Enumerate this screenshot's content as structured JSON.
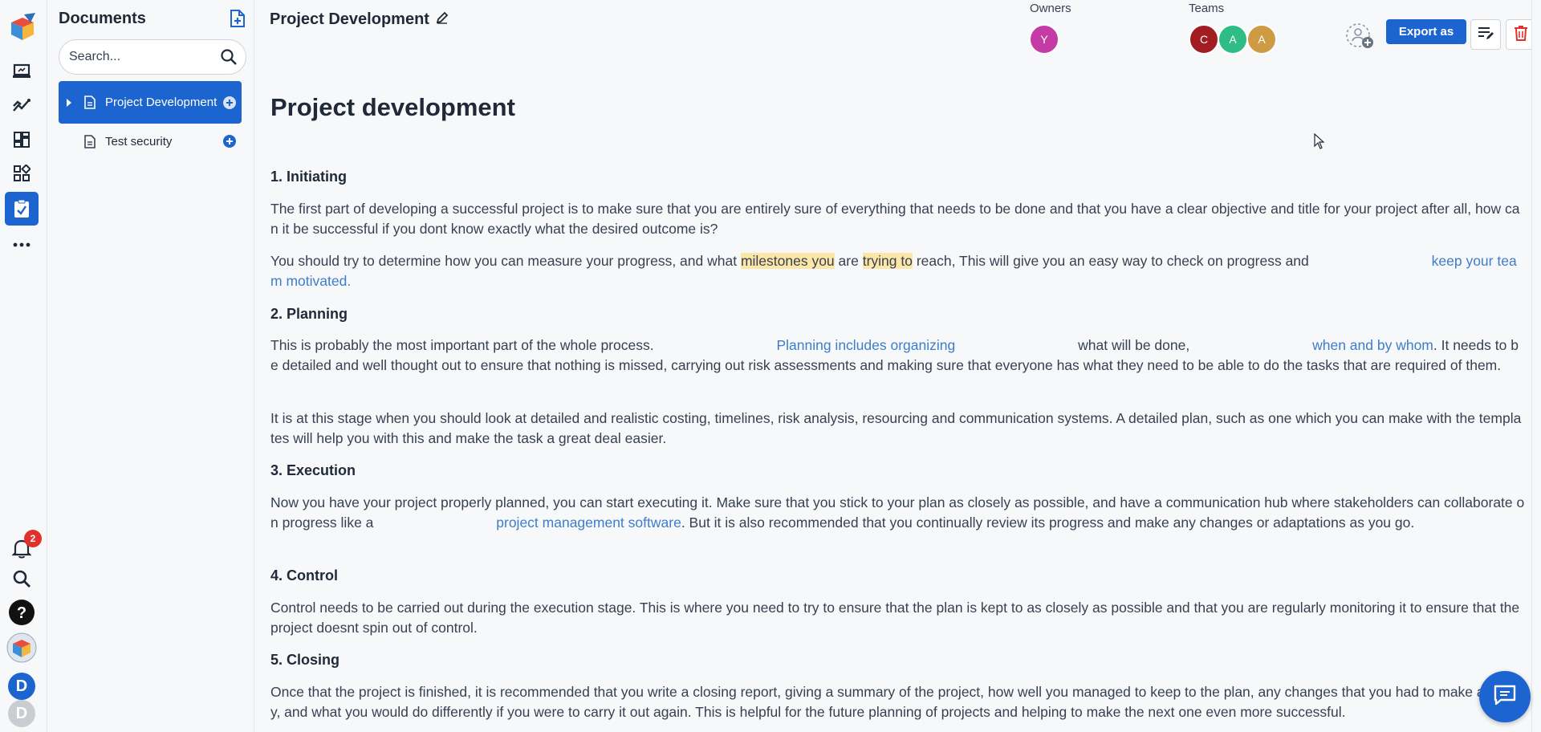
{
  "sidebar": {
    "title": "Documents",
    "search_placeholder": "Search...",
    "items": [
      {
        "label": "Project Development",
        "active": true
      },
      {
        "label": "Test security",
        "active": false
      }
    ]
  },
  "rail": {
    "notification_count": "2",
    "avatars": [
      "D",
      "D"
    ]
  },
  "header": {
    "title": "Project Development",
    "owners_label": "Owners",
    "teams_label": "Teams",
    "owners": [
      {
        "initial": "Y",
        "color": "#c53ba6"
      }
    ],
    "teams": [
      {
        "initial": "C",
        "color": "#a11d22"
      },
      {
        "initial": "A",
        "color": "#2ebd84"
      },
      {
        "initial": "A",
        "color": "#cf9a44"
      }
    ],
    "export_label": "Export as"
  },
  "document": {
    "heading": "Project development",
    "sections": [
      {
        "title": "1. Initiating",
        "p1": "The first part of developing a successful project is to make sure that you are entirely sure of everything that needs to be done and that you have a clear objective and title for your project after all, how can it be successful if you dont know exactly what the desired outcome is?",
        "p2a": "You should try to determine how you can measure your progress, and what ",
        "p2_hl1": "milestones you",
        "p2b": " are ",
        "p2_hl2": "trying to",
        "p2c": " reach, This will give you an easy way to check on progress and ",
        "p2_link": "keep your team motivated",
        "p2d": "."
      },
      {
        "title": "2. Planning",
        "p1a": "This is probably the most important part of the whole process. ",
        "p1_link1": "Planning includes organizing",
        "p1b": " what will be done, ",
        "p1_link2": "when and by whom",
        "p1c": ". It needs to be detailed and well thought out to ensure that nothing is missed, carrying out risk assessments and making sure that everyone has what they need to be able to do the tasks that are required of them.",
        "p2": "It is at this stage when you should look at detailed and realistic costing, timelines, risk analysis, resourcing and communication systems. A detailed plan, such as one which you can make with the templates will help you with this and make the task a great deal easier."
      },
      {
        "title": "3. Execution",
        "p1a": "Now you have your project properly planned, you can start executing it. Make sure that you stick to your plan as closely as possible, and have a communication hub where stakeholders can collaborate on progress like a ",
        "p1_link": "project management software",
        "p1b": ". But it is also recommended that you continually review its progress and make any changes or adaptations as you go."
      },
      {
        "title": "4. Control",
        "p1": "Control needs to be carried out during the execution stage. This is where you need to try to ensure that the plan is kept to as closely as possible and that you are regularly monitoring it to ensure that the project doesnt spin out of control."
      },
      {
        "title": "5. Closing",
        "p1": "Once that the project is finished, it is recommended that you write a closing report, giving a summary of the project, how well you managed to keep to the plan, any changes that you had to make and why, and what you would do differently if you were to carry it out again. This is helpful for the future planning of projects and helping to make the next one even more successful."
      }
    ]
  },
  "colors": {
    "accent": "#1c64cf",
    "link": "#3d7dc9",
    "highlight": "#fde7a8",
    "badge": "#e0312b"
  },
  "icons": [
    "app-logo-icon",
    "laptop-icon",
    "trend-icon",
    "dashboard-icon",
    "widgets-icon",
    "clipboard-icon",
    "more-icon",
    "bell-icon",
    "search-icon",
    "help-icon",
    "new-document-icon",
    "document-icon",
    "plus-circle-icon",
    "caret-right-icon",
    "edit-pencil-icon",
    "add-user-icon",
    "edit-list-icon",
    "trash-icon",
    "chat-icon"
  ]
}
